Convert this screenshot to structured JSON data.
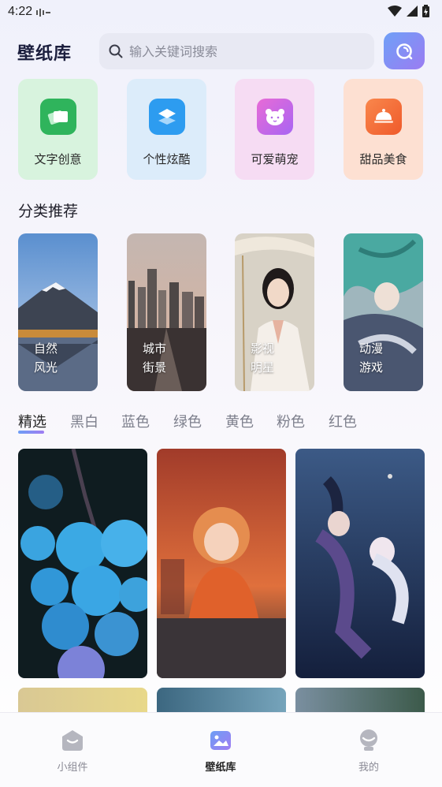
{
  "status_bar": {
    "time": "4:22"
  },
  "header": {
    "title": "壁纸库",
    "search_placeholder": "输入关键词搜索"
  },
  "categories": [
    {
      "label": "文字创意",
      "icon": "cards-icon",
      "color": "#2fb45c"
    },
    {
      "label": "个性炫酷",
      "icon": "layers-icon",
      "color": "#2d9cf0"
    },
    {
      "label": "可爱萌宠",
      "icon": "bear-icon",
      "color": "#c75cf0"
    },
    {
      "label": "甜品美食",
      "icon": "cake-icon",
      "color": "#f46a2a"
    }
  ],
  "section": {
    "title": "分类推荐"
  },
  "recommend": [
    {
      "line1": "自然",
      "line2": "风光"
    },
    {
      "line1": "城市",
      "line2": "街景"
    },
    {
      "line1": "影视",
      "line2": "明星"
    },
    {
      "line1": "动漫",
      "line2": "游戏"
    }
  ],
  "tabs": [
    "精选",
    "黑白",
    "蓝色",
    "绿色",
    "黄色",
    "粉色",
    "红色"
  ],
  "active_tab": "精选",
  "bottom_nav": [
    {
      "label": "小组件",
      "icon": "widget-icon",
      "active": false
    },
    {
      "label": "壁纸库",
      "icon": "gallery-icon",
      "active": true
    },
    {
      "label": "我的",
      "icon": "profile-icon",
      "active": false
    }
  ],
  "colors": {
    "accent_start": "#6d9ef5",
    "accent_end": "#a07df2",
    "title": "#1b1e3d"
  }
}
